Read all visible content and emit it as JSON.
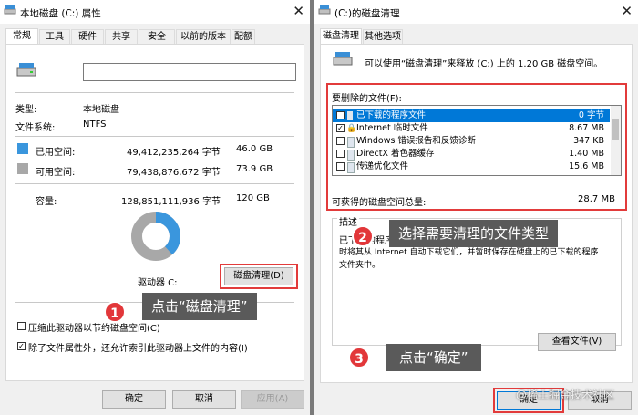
{
  "left": {
    "title": "本地磁盘 (C:) 属性",
    "tabs": [
      "常规",
      "工具",
      "硬件",
      "共享",
      "安全",
      "以前的版本",
      "配额"
    ],
    "type_label": "类型:",
    "type_value": "本地磁盘",
    "fs_label": "文件系统:",
    "fs_value": "NTFS",
    "used_label": "已用空间:",
    "used_bytes": "49,412,235,264 字节",
    "used_gb": "46.0 GB",
    "free_label": "可用空间:",
    "free_bytes": "79,438,876,672 字节",
    "free_gb": "73.9 GB",
    "cap_label": "容量:",
    "cap_bytes": "128,851,111,936 字节",
    "cap_gb": "120 GB",
    "drive_label": "驱动器 C:",
    "cleanup_button": "磁盘清理(D)",
    "compress_label": "压缩此驱动器以节约磁盘空间(C)",
    "index_label": "除了文件属性外，还允许索引此驱动器上文件的内容(I)",
    "ok": "确定",
    "cancel": "取消",
    "apply": "应用(A)",
    "used_color": "#3a96dd",
    "free_color": "#a8a8a8",
    "used_fraction": 0.383
  },
  "right": {
    "title": "(C:)的磁盘清理",
    "tabs": [
      "磁盘清理",
      "其他选项"
    ],
    "intro": "可以使用“磁盘清理”来释放 (C:) 上的 1.20 GB 磁盘空间。",
    "files_label": "要删除的文件(F):",
    "files": [
      {
        "name": "已下载的程序文件",
        "size": "0 字节",
        "checked": true
      },
      {
        "name": "Internet 临时文件",
        "size": "8.67 MB",
        "checked": true
      },
      {
        "name": "Windows 错误报告和反馈诊断",
        "size": "347 KB",
        "checked": false
      },
      {
        "name": "DirectX 着色器缓存",
        "size": "1.40 MB",
        "checked": false
      },
      {
        "name": "传递优化文件",
        "size": "15.6 MB",
        "checked": false
      }
    ],
    "total_label": "可获得的磁盘空间总量:",
    "total_value": "28.7 MB",
    "desc_title": "描述",
    "desc_line1": "已下载的程序文件",
    "desc_line2": "时将其从 Internet 自动下载它们，并暂时保存在硬盘上的已下载的程序",
    "desc_line3": "文件夹中。",
    "view_files": "查看文件(V)",
    "ok": "确定",
    "cancel": "取消"
  },
  "callouts": {
    "step1_num": "1",
    "step1_text": "点击“磁盘清理”",
    "step2_num": "2",
    "step2_text": "选择需要清理的文件类型",
    "step3_num": "3",
    "step3_text": "点击“确定”",
    "red_color": "#e23b3b"
  },
  "watermark": "@稀土掘金技术社区"
}
